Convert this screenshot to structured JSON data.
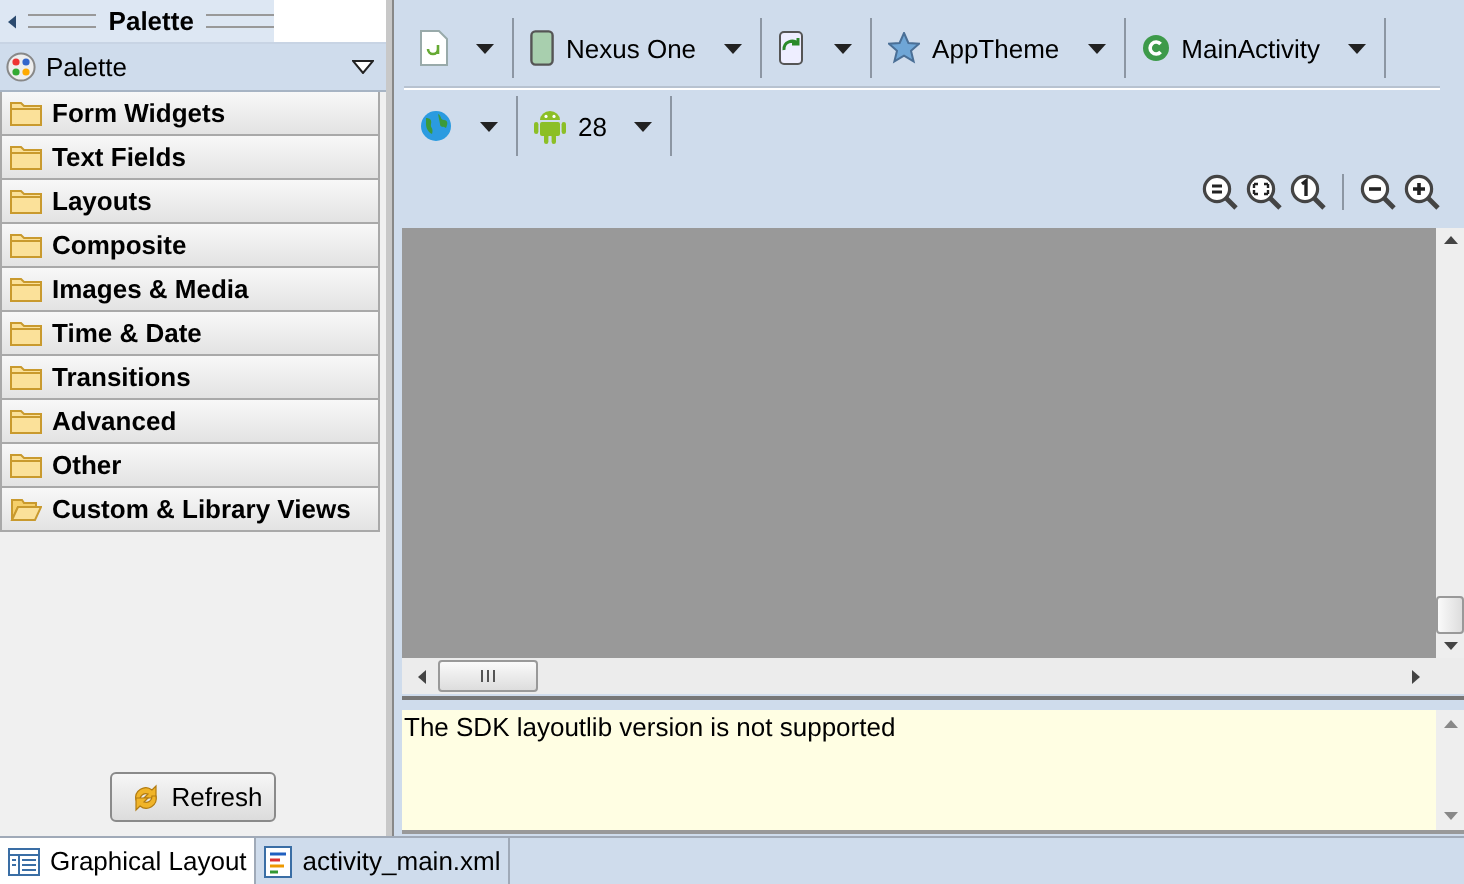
{
  "palette_tab": {
    "title": "Palette"
  },
  "palette_selector": {
    "label": "Palette"
  },
  "categories": [
    {
      "label": "Form Widgets",
      "expanded": false
    },
    {
      "label": "Text Fields",
      "expanded": false
    },
    {
      "label": "Layouts",
      "expanded": false
    },
    {
      "label": "Composite",
      "expanded": false
    },
    {
      "label": "Images & Media",
      "expanded": false
    },
    {
      "label": "Time & Date",
      "expanded": false
    },
    {
      "label": "Transitions",
      "expanded": false
    },
    {
      "label": "Advanced",
      "expanded": false
    },
    {
      "label": "Other",
      "expanded": false
    },
    {
      "label": "Custom & Library Views",
      "expanded": true
    }
  ],
  "refresh_button": {
    "label": "Refresh"
  },
  "toolbar": {
    "rows": [
      [
        {
          "kind": "layout"
        },
        {
          "kind": "device",
          "label": "Nexus One"
        },
        {
          "kind": "orientation"
        },
        {
          "kind": "theme",
          "label": "AppTheme"
        },
        {
          "kind": "activity",
          "label": "MainActivity"
        }
      ],
      [
        {
          "kind": "locale"
        },
        {
          "kind": "api",
          "label": "28"
        }
      ]
    ]
  },
  "error_message": "The SDK layoutlib version is not supported",
  "editor_tabs": [
    {
      "kind": "design",
      "label": "Graphical Layout",
      "selected": true
    },
    {
      "kind": "xml",
      "label": "activity_main.xml",
      "selected": false
    }
  ]
}
